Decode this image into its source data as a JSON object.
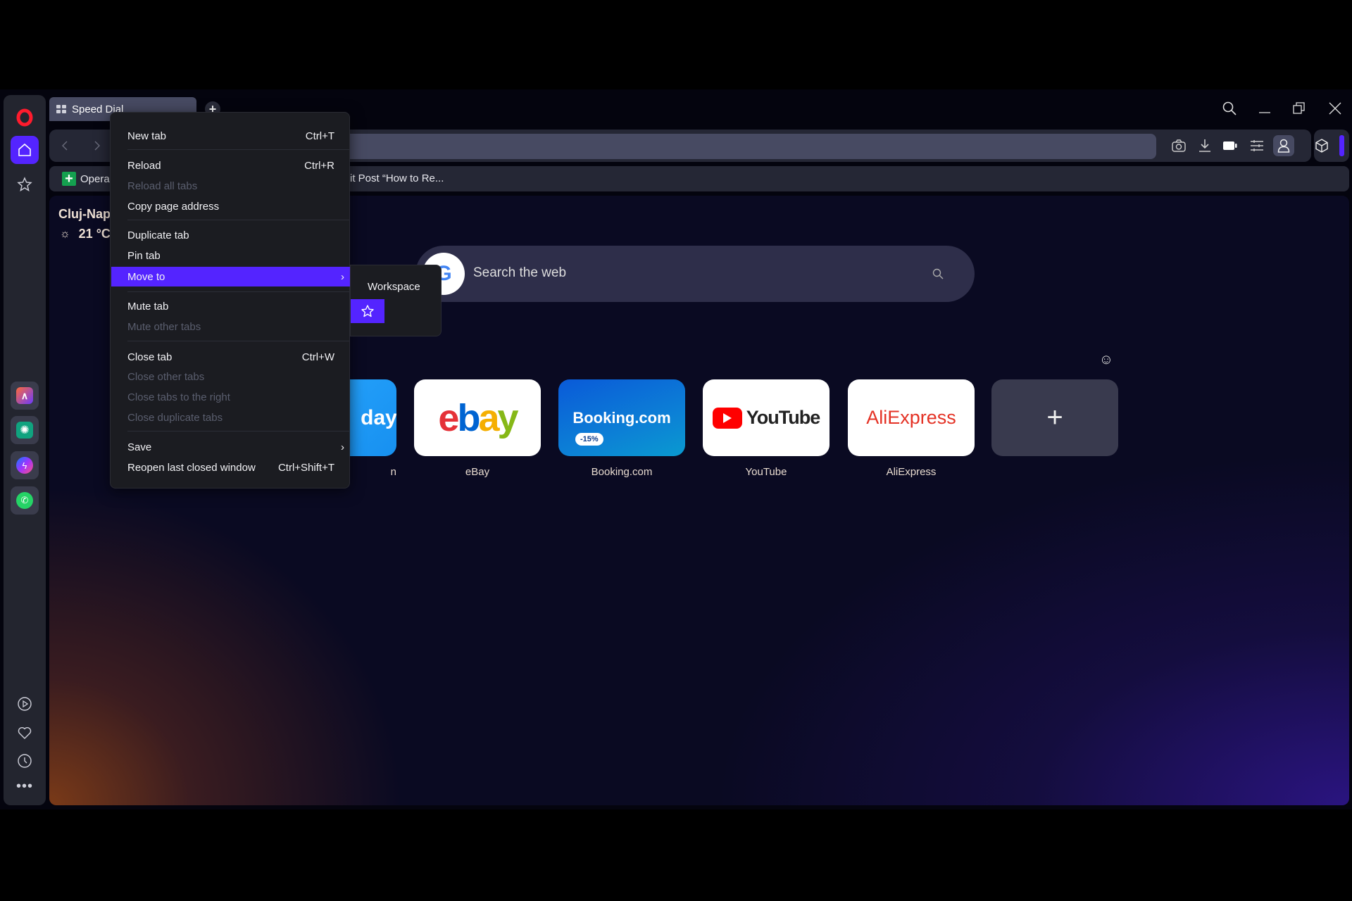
{
  "tab": {
    "title": "Speed Dial",
    "new_tab": "+"
  },
  "bookmarks": [
    {
      "label": "Opera"
    },
    {
      "label": "it Post “How to Re..."
    }
  ],
  "weather": {
    "city": "Cluj-Nap",
    "temp": "21 °C"
  },
  "search": {
    "placeholder": "Search the web"
  },
  "speed_dial": [
    {
      "label": "n",
      "logo": "day"
    },
    {
      "label": "eBay"
    },
    {
      "label": "Booking.com",
      "logo": "Booking.com",
      "badge": "-15%"
    },
    {
      "label": "YouTube",
      "logo": "YouTube"
    },
    {
      "label": "AliExpress",
      "logo": "AliExpress"
    },
    {
      "label": "",
      "logo": "+"
    }
  ],
  "menu": {
    "items": [
      {
        "label": "New tab",
        "shortcut": "Ctrl+T"
      },
      {
        "label": "Reload",
        "shortcut": "Ctrl+R"
      },
      {
        "label": "Reload all tabs",
        "disabled": true
      },
      {
        "label": "Copy page address"
      },
      {
        "label": "Duplicate tab"
      },
      {
        "label": "Pin tab"
      },
      {
        "label": "Move to",
        "submenu": true,
        "highlighted": true
      },
      {
        "label": "Mute tab"
      },
      {
        "label": "Mute other tabs",
        "disabled": true
      },
      {
        "label": "Close tab",
        "shortcut": "Ctrl+W"
      },
      {
        "label": "Close other tabs",
        "disabled": true
      },
      {
        "label": "Close tabs to the right",
        "disabled": true
      },
      {
        "label": "Close duplicate tabs",
        "disabled": true
      },
      {
        "label": "Save",
        "submenu": true
      },
      {
        "label": "Reopen last closed window",
        "shortcut": "Ctrl+Shift+T"
      }
    ],
    "submenu": {
      "title": "Workspace"
    }
  },
  "colors": {
    "accent": "#5424ff",
    "menu_bg": "#1b1c21",
    "sidebar_bg": "#23252f",
    "opera_red": "#ff1b2d"
  }
}
